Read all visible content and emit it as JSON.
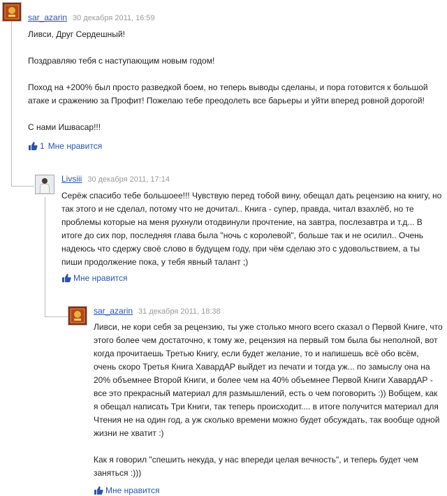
{
  "colors": {
    "link": "#2b56a8",
    "meta": "#9a9a9a",
    "text": "#222222",
    "thread_line": "#bcbcbc"
  },
  "comments": [
    {
      "author": "sar_azarin",
      "date": "30 декабря 2011, 16:59",
      "paragraphs": [
        "Ливси, Друг Сердешный!",
        "Поздравляю тебя с наступающим новым годом!",
        "Поход на +200% был просто разведкой боем, но теперь выводы сделаны, и пора готовится к большой атаке и сражению за Профит! Пожелаю тебе преодолеть все барьеры и уйти вперед ровной дорогой!",
        "С нами Ишвасар!!!"
      ],
      "like_count": "1",
      "like_label": "Мне нравится"
    },
    {
      "author": "Livsiii",
      "date": "30 декабря 2011, 17:14",
      "paragraphs": [
        "Серёж спасибо тебе большоее!!! Чувствую перед тобой вину, обещал дать рецензию на книгу, но так этого и не сделал, потому что не дочитал.. Книга - супер, правда, читал взахлёб, но те проблемы которые на меня рухнули отодвинули прочтение, на завтра, послезавтра и т.д... В итоге до сих пор, последняя глава была \"ночь с королевой\", больше так и не осилил.. Очень надеюсь что сдержу своё слово в будущем году, при чём сделаю это с удовольствием, а ты пиши продолжение пока, у тебя явный талант ;)"
      ],
      "like_count": "",
      "like_label": "Мне нравится"
    },
    {
      "author": "sar_azarin",
      "date": "31 декабря 2011, 18:38",
      "paragraphs": [
        "Ливси, не кори себя за рецензию, ты уже столько много всего сказал о Первой Книге, что этого более чем достаточно, к тому же, рецензия на первый том была бы неполной, вот когда прочитаешь Третью Книгу, если будет желание, то и напишешь всё обо всём, очень скоро Третья Книга ХавардАР выйдет из печати и тогда уж... по замыслу она на 20% объемнее Второй Книги, и более чем на 40% объемнее Первой Книги ХавардАР - все это прекрасный материал для размышлений, есть о чем поговорить :)) Вобщем, как я обещал написать Три Книги, так теперь происходит.... в итоге получится материал для Чтения не на один год, а уж сколько времени можно будет обсуждать, так вообще одной жизни не хватит :)",
        "Как я говорил \"спешить некуда, у нас впереди целая вечность\", и теперь будет чем заняться :)))"
      ],
      "like_count": "",
      "like_label": "Мне нравится"
    }
  ]
}
